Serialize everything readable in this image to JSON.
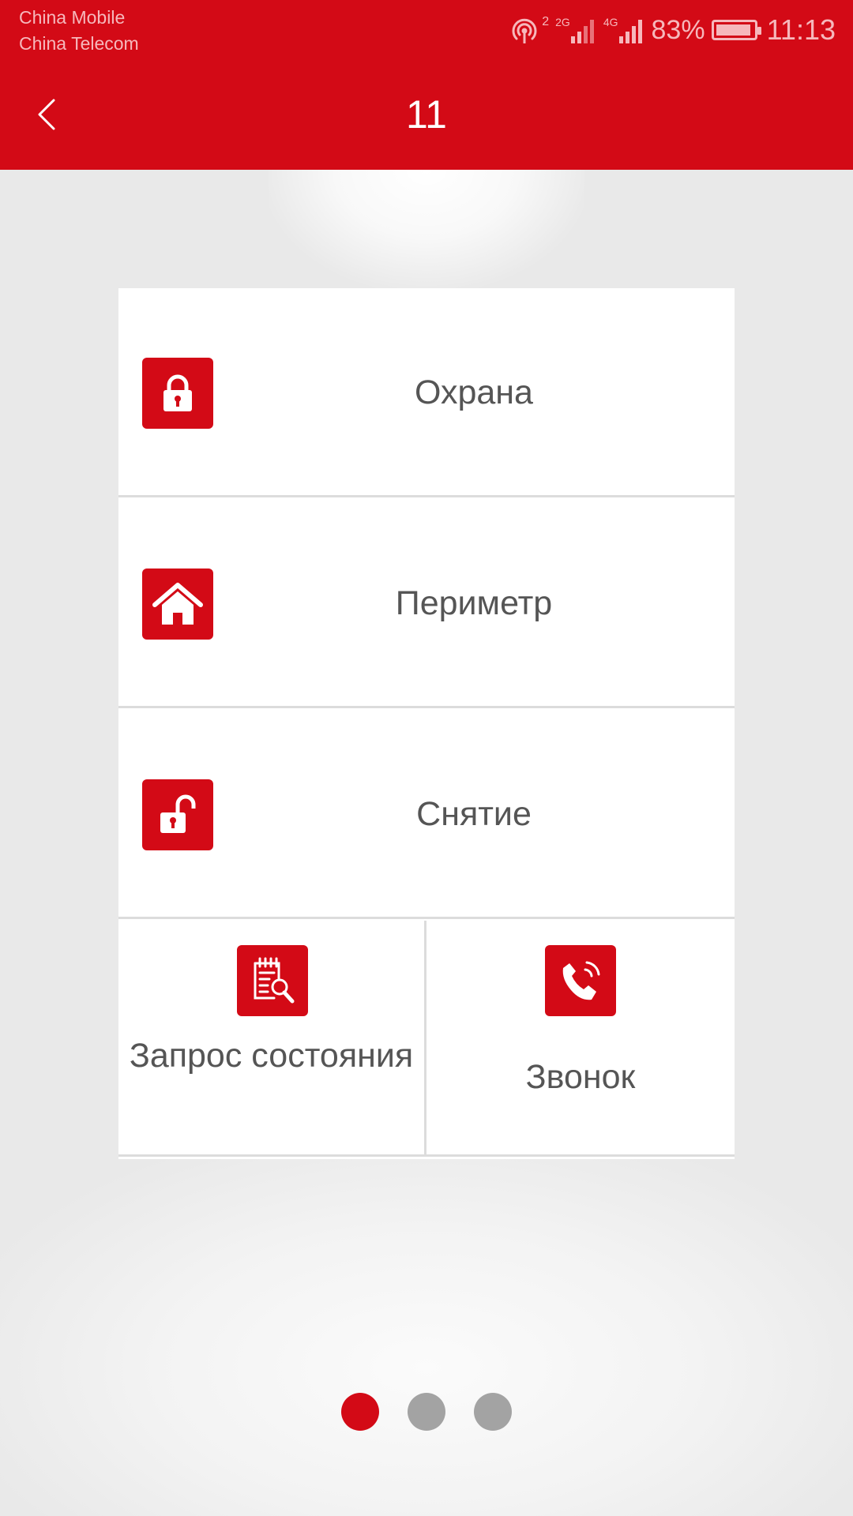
{
  "status_bar": {
    "carrier_1": "China Mobile",
    "carrier_2": "China Telecom",
    "network_1": "2G",
    "network_2": "4G",
    "hotspot_count": "2",
    "battery": "83%",
    "time": "11:13"
  },
  "header": {
    "title": "11"
  },
  "menu": {
    "arm": {
      "label": "Охрана",
      "icon": "lock-icon"
    },
    "perimeter": {
      "label": "Периметр",
      "icon": "home-icon"
    },
    "disarm": {
      "label": "Снятие",
      "icon": "unlock-icon"
    },
    "status": {
      "label": "Запрос состояния",
      "icon": "document-search-icon"
    },
    "call": {
      "label": "Звонок",
      "icon": "phone-icon"
    }
  },
  "pager": {
    "page_count": 3,
    "active_index": 0
  },
  "colors": {
    "accent": "#d30a16",
    "inactive_dot": "#a3a3a3",
    "text": "#555555",
    "background": "#e9e9e9"
  }
}
